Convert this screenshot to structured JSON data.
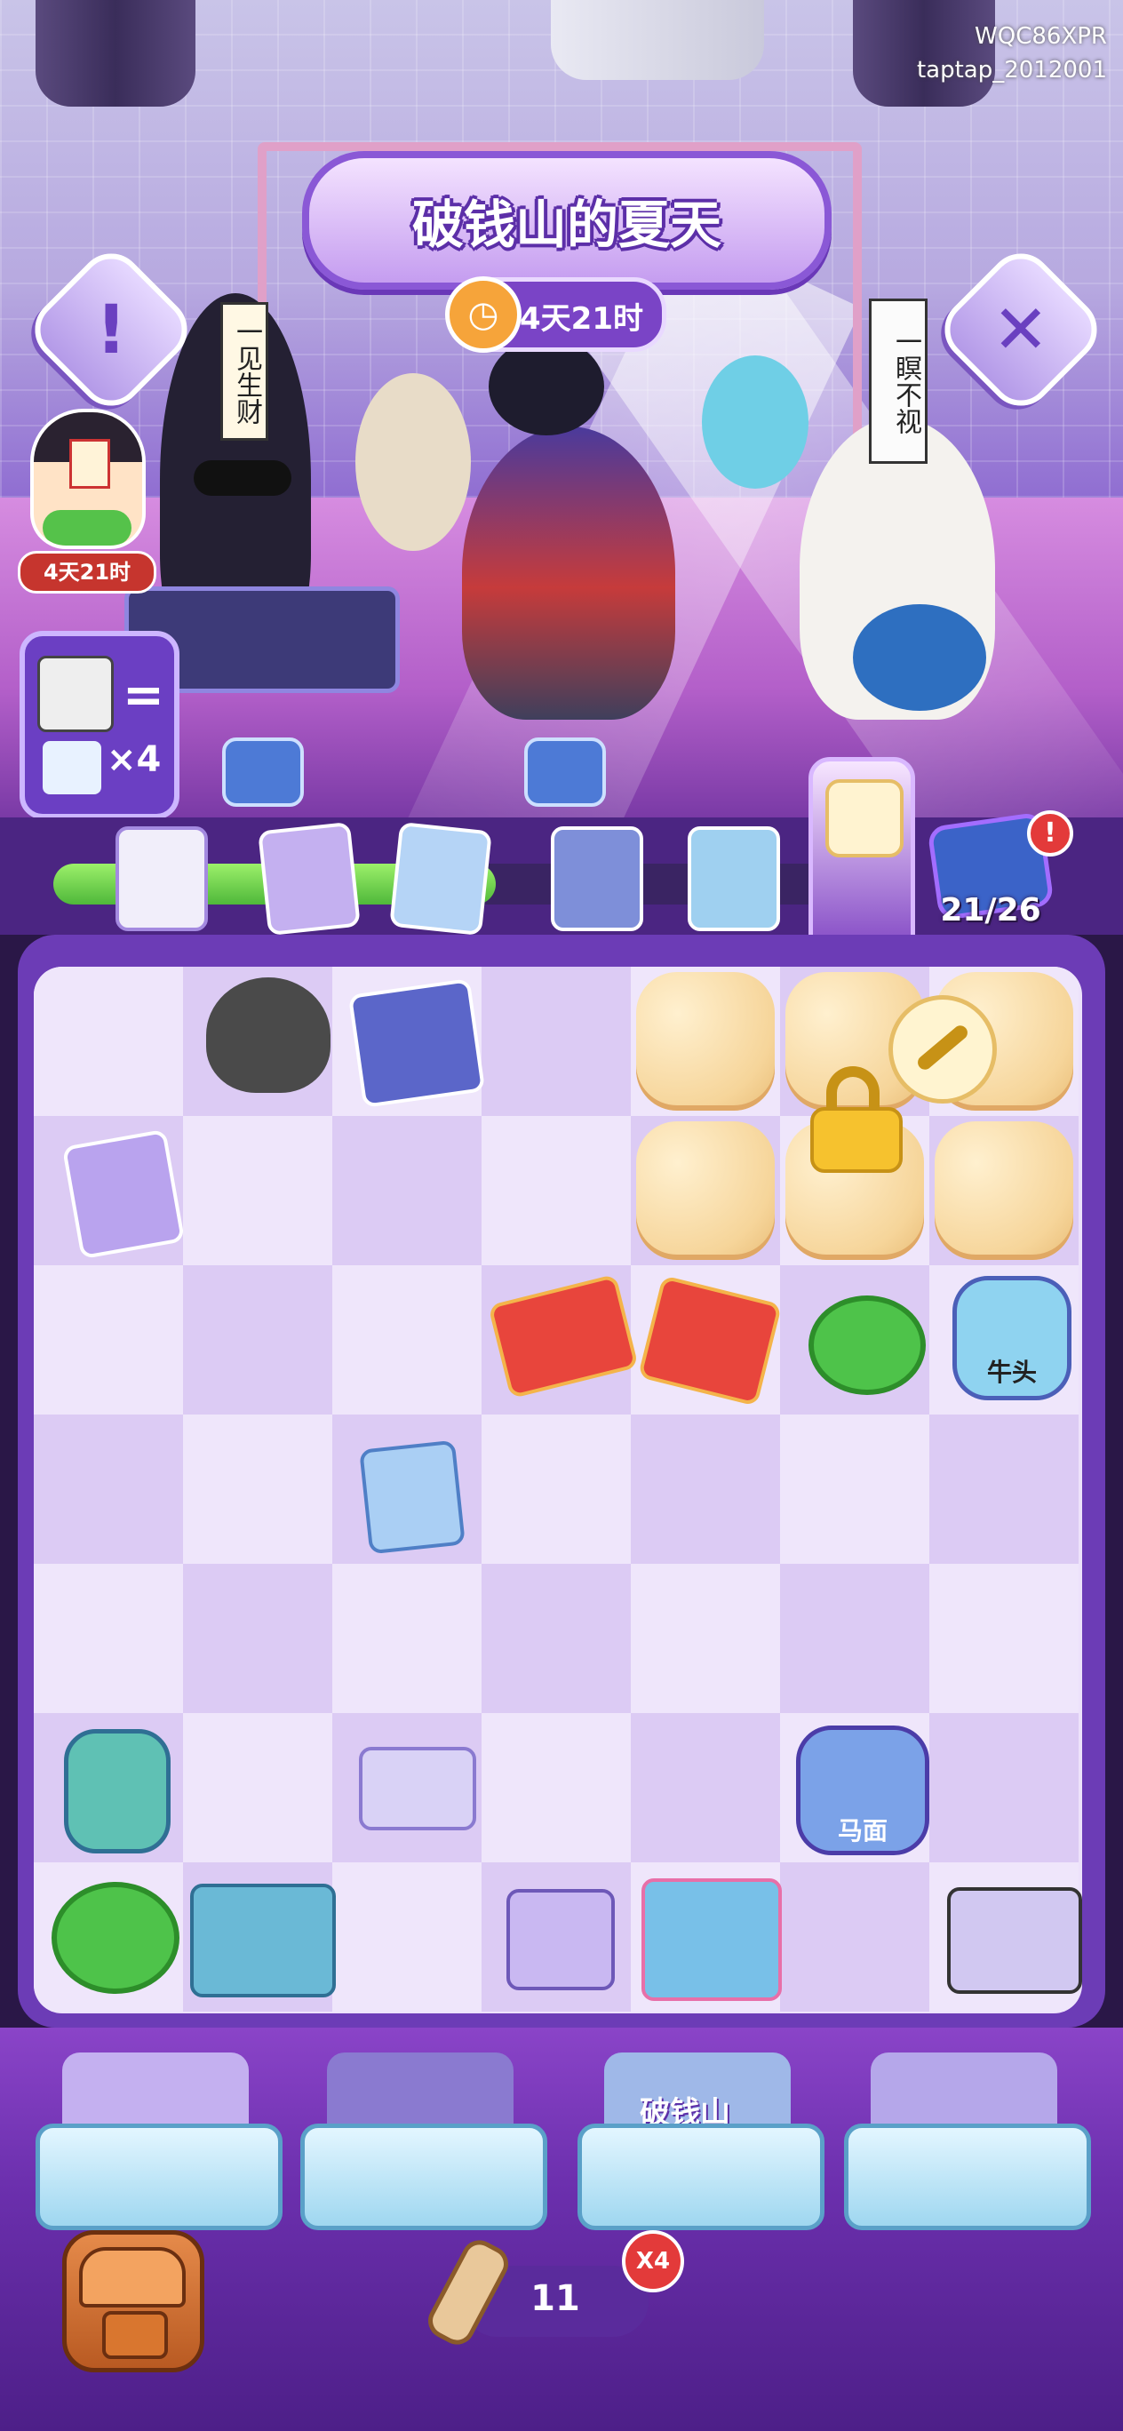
{
  "watermark": {
    "line1": "WQC86XPR",
    "line2": "taptap_2012001"
  },
  "event": {
    "title": "破钱山的夏天",
    "timer": "4天21时"
  },
  "characters": {
    "left_sign": "一见生财",
    "right_sign": "一瞑不视"
  },
  "side_event": {
    "timer": "4天21时"
  },
  "recipe": {
    "equals": "=",
    "multiplier": "×4"
  },
  "collection": {
    "counter": "21/26",
    "alert": "!",
    "progress": 0.56
  },
  "board_items": {
    "bull_label": "牛头",
    "horse_label": "马面"
  },
  "baskets": [
    {
      "name": "basket-1",
      "label": ""
    },
    {
      "name": "basket-2",
      "label": ""
    },
    {
      "name": "basket-3",
      "label": "破钱山"
    },
    {
      "name": "basket-4",
      "label": ""
    }
  ],
  "energy": {
    "count": "11",
    "boost": "X4"
  },
  "colors": {
    "accent": "#8a58d6",
    "progress": "#4fb83a",
    "alert": "#e33a3a",
    "lock": "#f6c22e"
  },
  "icons": {
    "info": "!",
    "close": "✕"
  }
}
